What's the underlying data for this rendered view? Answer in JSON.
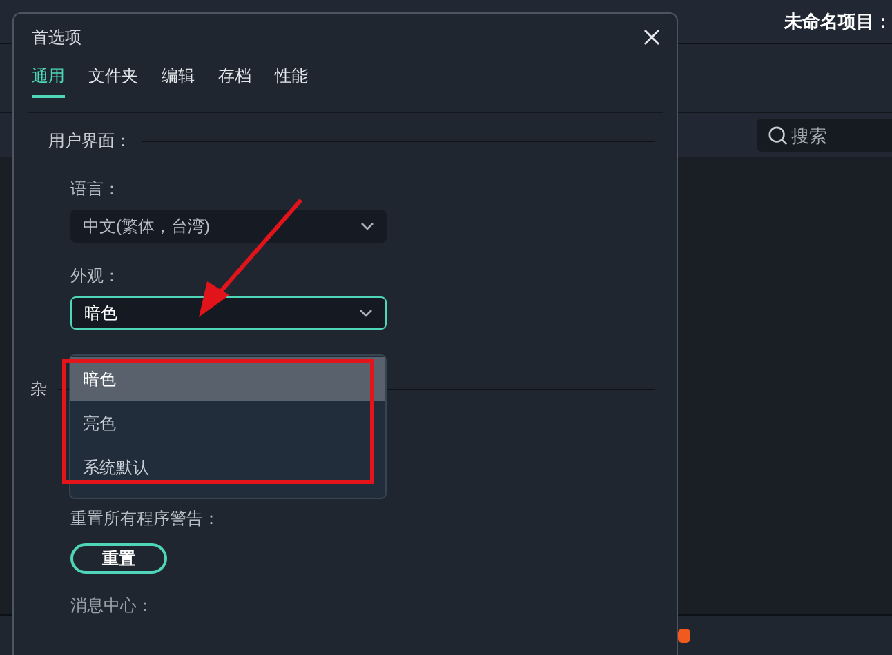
{
  "app": {
    "project_title": "未命名项目：",
    "search": {
      "placeholder": "搜索"
    }
  },
  "dialog": {
    "title": "首选项",
    "tabs": [
      {
        "label": "通用",
        "selected": true
      },
      {
        "label": "文件夹",
        "selected": false
      },
      {
        "label": "编辑",
        "selected": false
      },
      {
        "label": "存档",
        "selected": false
      },
      {
        "label": "性能",
        "selected": false
      }
    ],
    "section_title": "用户界面：",
    "language": {
      "label": "语言：",
      "value": "中文(繁体，台湾)"
    },
    "appearance": {
      "label": "外观：",
      "value": "暗色",
      "expanded": true,
      "options": [
        {
          "label": "暗色",
          "selected": true
        },
        {
          "label": "亮色",
          "selected": false
        },
        {
          "label": "系统默认",
          "selected": false
        }
      ]
    },
    "misc_section_title": "杂",
    "reset_warnings": {
      "label": "重置所有程序警告：",
      "button": "重置"
    },
    "message_center": {
      "label": "消息中心："
    }
  }
}
